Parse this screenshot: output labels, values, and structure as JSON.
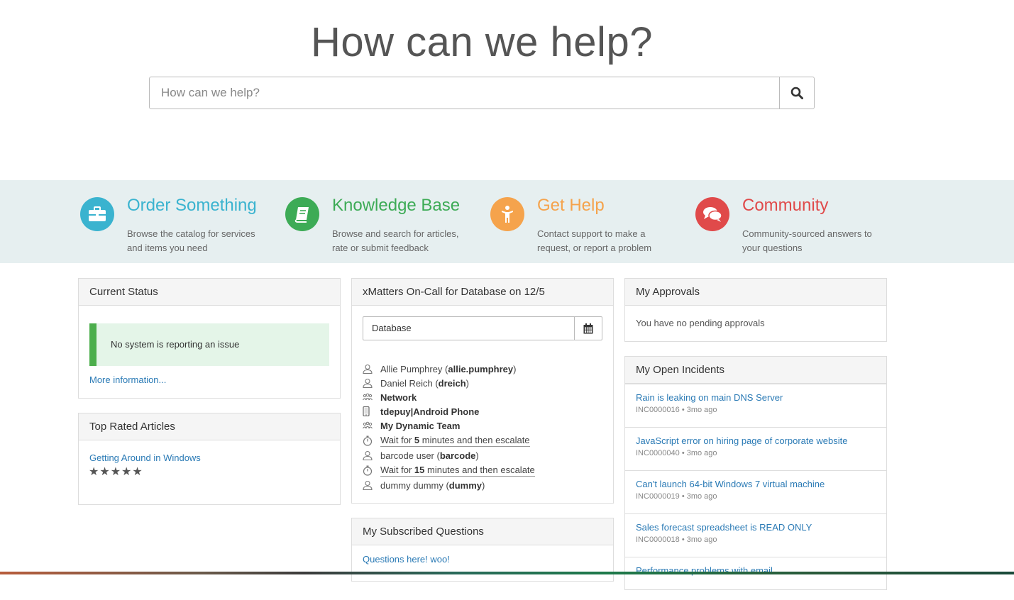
{
  "hero": {
    "title": "How can we help?",
    "search_placeholder": "How can we help?",
    "search_icon": "search-icon"
  },
  "tiles": [
    {
      "title": "Order Something",
      "desc": "Browse the catalog for services and items you need",
      "color": "#3ab3cf",
      "icon": "briefcase-icon"
    },
    {
      "title": "Knowledge Base",
      "desc": "Browse and search for articles, rate or submit feedback",
      "color": "#3dab56",
      "icon": "book-icon"
    },
    {
      "title": "Get Help",
      "desc": "Contact support to make a request, or report a problem",
      "color": "#f5a34c",
      "icon": "person-icon"
    },
    {
      "title": "Community",
      "desc": "Community-sourced answers to your questions",
      "color": "#e04a4a",
      "icon": "chat-bubbles-icon"
    }
  ],
  "current_status": {
    "header": "Current Status",
    "message": "No system is reporting an issue",
    "more_link": "More information..."
  },
  "top_rated": {
    "header": "Top Rated Articles",
    "article": "Getting Around in Windows",
    "rating": 5,
    "stars": "★★★★★"
  },
  "oncall": {
    "header": "xMatters On-Call for Database on 12/5",
    "input_value": "Database",
    "rows": [
      {
        "icon": "user-icon",
        "pre": "Allie Pumphrey (",
        "bold": "allie.pumphrey",
        "post": ")"
      },
      {
        "icon": "user-icon",
        "pre": "Daniel Reich (",
        "bold": "dreich",
        "post": ")"
      },
      {
        "icon": "group-icon",
        "pre": "",
        "bold": "Network",
        "post": ""
      },
      {
        "icon": "phone-icon",
        "pre": "",
        "bold": "tdepuy|Android Phone",
        "post": ""
      },
      {
        "icon": "group-icon",
        "pre": "",
        "bold": "My Dynamic Team",
        "post": ""
      },
      {
        "icon": "timer-icon",
        "pre": "Wait for ",
        "bold": "5",
        "post": " minutes and then escalate",
        "wait": true
      },
      {
        "icon": "user-icon",
        "pre": "barcode user (",
        "bold": "barcode",
        "post": ")"
      },
      {
        "icon": "timer-icon",
        "pre": "Wait for ",
        "bold": "15",
        "post": " minutes and then escalate",
        "wait": true
      },
      {
        "icon": "user-icon",
        "pre": "dummy dummy (",
        "bold": "dummy",
        "post": ")"
      }
    ]
  },
  "subscribed": {
    "header": "My Subscribed Questions",
    "first_question": "Questions here! woo!"
  },
  "approvals": {
    "header": "My Approvals",
    "message": "You have no pending approvals"
  },
  "incidents": {
    "header": "My Open Incidents",
    "items": [
      {
        "title": "Rain is leaking on main DNS Server",
        "meta": "INC0000016 • 3mo ago"
      },
      {
        "title": "JavaScript error on hiring page of corporate website",
        "meta": "INC0000040 • 3mo ago"
      },
      {
        "title": "Can't launch 64-bit Windows 7 virtual machine",
        "meta": "INC0000019 • 3mo ago"
      },
      {
        "title": "Sales forecast spreadsheet is READ ONLY",
        "meta": "INC0000018 • 3mo ago"
      },
      {
        "title": "Performance problems with email",
        "meta": ""
      }
    ]
  }
}
